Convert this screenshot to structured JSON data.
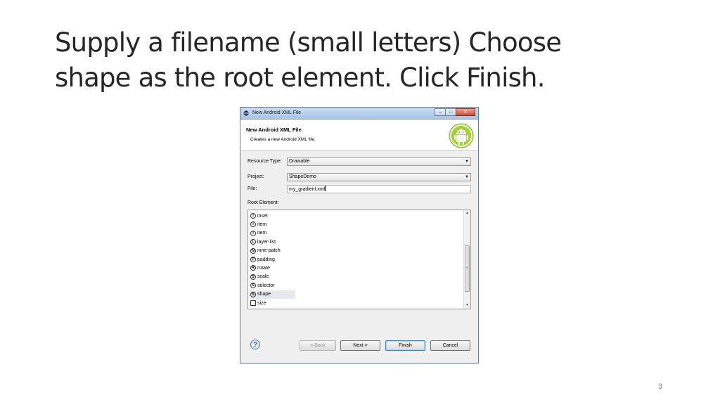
{
  "slide": {
    "title_line1": "Supply a filename (small letters) Choose",
    "title_line2": "shape as the root element.  Click Finish.",
    "page_number": "3"
  },
  "dialog": {
    "window_title": "New Android XML File",
    "banner_title": "New Android XML File",
    "banner_description": "Creates a new Android XML file.",
    "resource_type": {
      "label": "Resource Type:",
      "value": "Drawable"
    },
    "project": {
      "label": "Project:",
      "value": "ShapeDemo"
    },
    "file": {
      "label": "File:",
      "value": "my_gradient.xml"
    },
    "root_element_label": "Root Element:",
    "root_elements": [
      {
        "icon": "I",
        "label": "inset"
      },
      {
        "icon": "I",
        "label": "item"
      },
      {
        "icon": "I",
        "label": "item"
      },
      {
        "icon": "L",
        "label": "layer-list"
      },
      {
        "icon": "N",
        "label": "nine-patch"
      },
      {
        "icon": "P",
        "label": "padding"
      },
      {
        "icon": "R",
        "label": "rotate"
      },
      {
        "icon": "S",
        "label": "scale"
      },
      {
        "icon": "S",
        "label": "selector"
      },
      {
        "icon": "S",
        "label": "shape",
        "selected": true
      },
      {
        "icon": "",
        "label": "size"
      }
    ],
    "buttons": {
      "back": "< Back",
      "next": "Next >",
      "finish": "Finish",
      "cancel": "Cancel"
    },
    "icons": {
      "app": "eclipse-icon",
      "logo": "android-logo",
      "help": "help-icon"
    }
  },
  "colors": {
    "title_text": "#262626",
    "android_green": "#97c024",
    "titlebar": "#b8cfeb"
  }
}
